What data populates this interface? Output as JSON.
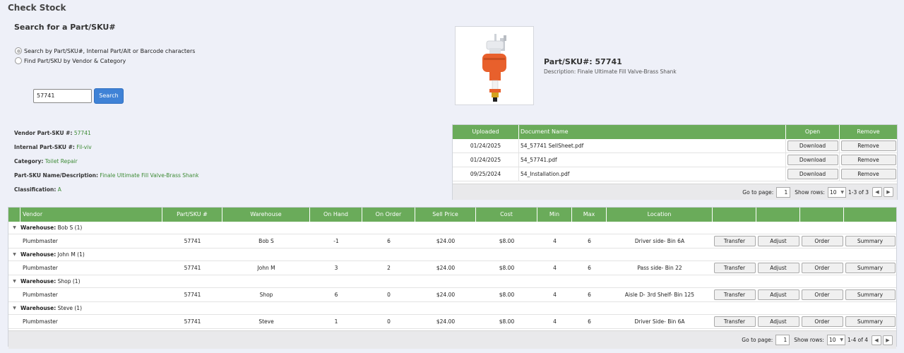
{
  "page_title": "Check Stock",
  "search": {
    "title": "Search for a Part/SKU#",
    "option1": "Search by Part/SKU#, Internal Part/Alt or Barcode characters",
    "option2": "Find Part/SKU by Vendor & Category",
    "input_value": "57741",
    "button": "Search"
  },
  "product": {
    "title": "Part/SKU#: 57741",
    "description": "Description: Finale Ultimate Fill Valve-Brass Shank"
  },
  "details": [
    {
      "label": "Vendor Part-SKU #:",
      "value": "57741"
    },
    {
      "label": "Internal Part-SKU #:",
      "value": "Fil-viv"
    },
    {
      "label": "Category:",
      "value": "Toilet Repair"
    },
    {
      "label": "Part-SKU Name/Description:",
      "value": "Finale Ultimate Fill Valve-Brass Shank"
    },
    {
      "label": "Classification:",
      "value": "A"
    }
  ],
  "documents": {
    "headers": [
      "Uploaded",
      "Document Name",
      "Open",
      "Remove"
    ],
    "rows": [
      {
        "uploaded": "01/24/2025",
        "name": "54_57741 SellSheet.pdf",
        "open": "Download",
        "remove": "Remove"
      },
      {
        "uploaded": "01/24/2025",
        "name": "54_57741.pdf",
        "open": "Download",
        "remove": "Remove"
      },
      {
        "uploaded": "09/25/2024",
        "name": "54_Installation.pdf",
        "open": "Download",
        "remove": "Remove"
      }
    ],
    "pager": {
      "goto_label": "Go to page:",
      "page": "1",
      "rows_label": "Show rows:",
      "rows": "10",
      "range": "1-3 of 3"
    }
  },
  "stock": {
    "headers": [
      "Vendor",
      "Part/SKU #",
      "Warehouse",
      "On Hand",
      "On Order",
      "Sell Price",
      "Cost",
      "Min",
      "Max",
      "Location"
    ],
    "group_label": "Warehouse:",
    "groups": [
      {
        "warehouse": "Bob S (1)",
        "row": {
          "vendor": "Plumbmaster",
          "sku": "57741",
          "warehouse": "Bob S",
          "on_hand": "-1",
          "on_order": "6",
          "sell": "$24.00",
          "cost": "$8.00",
          "min": "4",
          "max": "6",
          "location": "Driver side- Bin 6A"
        }
      },
      {
        "warehouse": "John M (1)",
        "row": {
          "vendor": "Plumbmaster",
          "sku": "57741",
          "warehouse": "John M",
          "on_hand": "3",
          "on_order": "2",
          "sell": "$24.00",
          "cost": "$8.00",
          "min": "4",
          "max": "6",
          "location": "Pass side- Bin 22"
        }
      },
      {
        "warehouse": "Shop (1)",
        "row": {
          "vendor": "Plumbmaster",
          "sku": "57741",
          "warehouse": "Shop",
          "on_hand": "6",
          "on_order": "0",
          "sell": "$24.00",
          "cost": "$8.00",
          "min": "4",
          "max": "6",
          "location": "Aisle D- 3rd Shelf- Bin 125"
        }
      },
      {
        "warehouse": "Steve (1)",
        "row": {
          "vendor": "Plumbmaster",
          "sku": "57741",
          "warehouse": "Steve",
          "on_hand": "1",
          "on_order": "0",
          "sell": "$24.00",
          "cost": "$8.00",
          "min": "4",
          "max": "6",
          "location": "Driver Side- Bin 6A"
        }
      }
    ],
    "actions": [
      "Transfer",
      "Adjust",
      "Order",
      "Summary"
    ],
    "pager": {
      "goto_label": "Go to page:",
      "page": "1",
      "rows_label": "Show rows:",
      "rows": "10",
      "range": "1-4 of 4"
    }
  },
  "colors": {
    "header_green": "#6aab5a",
    "value_green": "#3d8b35",
    "search_blue": "#3f82d6"
  }
}
